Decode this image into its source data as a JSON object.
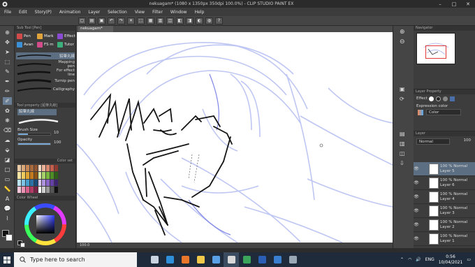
{
  "window": {
    "title": "nekuagam* (1080 x 1350px 350dpi 100.0%) - CLIP STUDIO PAINT EX",
    "min_label": "–",
    "max_label": "□",
    "close_label": "✕"
  },
  "menu": [
    "File",
    "Edit",
    "Story(P)",
    "Animation",
    "Layer",
    "Selection",
    "View",
    "Filter",
    "Window",
    "Help"
  ],
  "sub_tool": {
    "header": "Sub Tool [Pen]",
    "groups": [
      {
        "label": "Pen",
        "color": "#d24b4b"
      },
      {
        "label": "Mark",
        "color": "#e0a43a"
      },
      {
        "label": "Effect",
        "color": "#8a4bd2"
      },
      {
        "label": "Avan",
        "color": "#3b8fd6"
      },
      {
        "label": "FS m",
        "color": "#d24b8a"
      },
      {
        "label": "Tutor",
        "color": "#3bb07a"
      }
    ],
    "brushes": [
      "鉛筆丸線",
      "Mapping pen",
      "For effect line",
      "Turnip pen",
      "Calligraphy"
    ]
  },
  "tool_property": {
    "header": "Tool property [鉛筆丸線]",
    "brush_name": "鉛筆丸線",
    "brush_size_label": "Brush Size",
    "brush_size_value": "10",
    "opacity_label": "Opacity",
    "opacity_value": "100",
    "opacity_fraction": 1.0
  },
  "color_set": {
    "header": "Color set",
    "swatches": [
      "#e8c9a6",
      "#d9a77a",
      "#c78655",
      "#a96b3e",
      "#8e5530",
      "#f2d6c2",
      "#eab39a",
      "#d98870",
      "#c45e4c",
      "#8f3a30",
      "#f7e3a1",
      "#f0cc5e",
      "#e0a531",
      "#c27a1c",
      "#8c5214",
      "#d7eaa8",
      "#a8d36b",
      "#79b83d",
      "#4e8c26",
      "#2f5e18",
      "#b9e2f2",
      "#7ec4e6",
      "#479fd0",
      "#2c72a8",
      "#1a4b78",
      "#d6c5ef",
      "#b093de",
      "#8a66c9",
      "#643fa6",
      "#3f2373",
      "#f5c6d8",
      "#ec93b4",
      "#d9608b",
      "#b13a66",
      "#7a2245",
      "#ffffff",
      "#d0d0d0",
      "#9a9a9a",
      "#555555",
      "#111111"
    ]
  },
  "color_wheel": {
    "header": "Color Wheel",
    "main_color": "#111111",
    "sub_color": "#ffffff"
  },
  "canvas": {
    "tab_label": "nekuagam*",
    "status": "100.0"
  },
  "navigator": {
    "header": "Navigator"
  },
  "layer_property": {
    "header": "Layer Property",
    "effect_label": "Effect",
    "expression_label": "Expression color",
    "expression_value": "Color"
  },
  "layers": {
    "header": "Layer",
    "blend": "Normal",
    "opacity": "100",
    "items": [
      {
        "percent": "100 % Normal",
        "name": "Layer 5",
        "selected": true
      },
      {
        "percent": "100 % Normal",
        "name": "Layer 6",
        "selected": false
      },
      {
        "percent": "100 % Normal",
        "name": "Layer 4",
        "selected": false
      },
      {
        "percent": "100 % Normal",
        "name": "Layer 3",
        "selected": false
      },
      {
        "percent": "100 % Normal",
        "name": "Layer 2",
        "selected": false
      },
      {
        "percent": "100 % Normal",
        "name": "Layer 1",
        "selected": false
      }
    ]
  },
  "taskbar": {
    "search_placeholder": "Type here to search",
    "apps": [
      {
        "icon": "task-view-icon",
        "color": "#c9d4e0"
      },
      {
        "icon": "edge-icon",
        "color": "#2f8fd8"
      },
      {
        "icon": "firefox-icon",
        "color": "#e8762b"
      },
      {
        "icon": "file-explorer-icon",
        "color": "#f2c84b"
      },
      {
        "icon": "store-icon",
        "color": "#5aa0e6"
      },
      {
        "icon": "clip-studio-icon",
        "color": "#d8d8d8"
      },
      {
        "icon": "chrome-icon",
        "color": "#3ba55c"
      },
      {
        "icon": "word-icon",
        "color": "#2b5eb5"
      },
      {
        "icon": "mail-icon",
        "color": "#3a7fcf"
      },
      {
        "icon": "settings-icon",
        "color": "#9aa7b4"
      }
    ],
    "language": "ENG",
    "time": "0:56",
    "date": "10/04/2021"
  }
}
